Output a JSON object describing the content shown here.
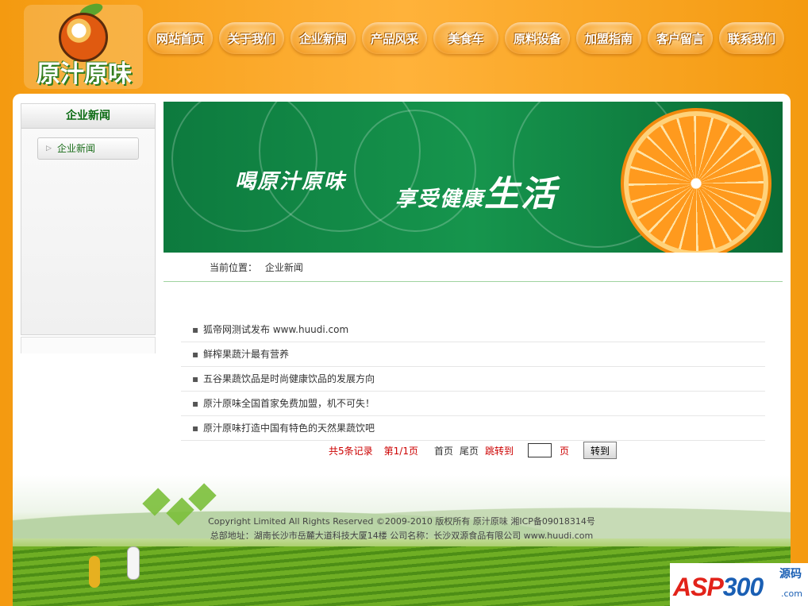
{
  "brand": {
    "logo_text": "原汁原味"
  },
  "nav": {
    "items": [
      {
        "label": "网站首页"
      },
      {
        "label": "关于我们"
      },
      {
        "label": "企业新闻"
      },
      {
        "label": "产品风采"
      },
      {
        "label": "美食车"
      },
      {
        "label": "原料设备"
      },
      {
        "label": "加盟指南"
      },
      {
        "label": "客户留言"
      },
      {
        "label": "联系我们"
      }
    ]
  },
  "sidebar": {
    "title": "企业新闻",
    "items": [
      {
        "label": "企业新闻"
      }
    ]
  },
  "banner": {
    "slogan_left": "喝原汁原味",
    "slogan_right_a": "享受健康",
    "slogan_right_b": "生活"
  },
  "breadcrumb": {
    "label": "当前位置：",
    "current": "企业新闻"
  },
  "news": {
    "items": [
      {
        "title": "狐帝网测试发布 www.huudi.com"
      },
      {
        "title": "鲜榨果蔬汁最有营养"
      },
      {
        "title": "五谷果蔬饮品是时尚健康饮品的发展方向"
      },
      {
        "title": "原汁原味全国首家免费加盟，机不可失！"
      },
      {
        "title": "原汁原味打造中国有特色的天然果蔬饮吧"
      }
    ]
  },
  "pager": {
    "total": "共5条记录",
    "page": "第1/1页",
    "first": "首页",
    "last": "尾页",
    "jump": "跳转到",
    "page_unit": "页",
    "go_button": "转到",
    "input_value": ""
  },
  "footer": {
    "line1": "Copyright Limited  All Rights Reserved  ©2009-2010 版权所有 原汁原味  湘ICP备09018314号",
    "line2": "总部地址：湖南长沙市岳麓大道科技大厦14楼  公司名称：长沙双源食品有限公司  www.huudi.com"
  },
  "watermark": {
    "brand_a": "ASP",
    "brand_b": "300",
    "cn": "源码",
    "com": ".com"
  },
  "colors": {
    "header_orange": "#f49a10",
    "nav_text": "#ffffff",
    "banner_green": "#0d7a3e",
    "link_green": "#1a6d1a",
    "pager_red": "#cc0000"
  }
}
